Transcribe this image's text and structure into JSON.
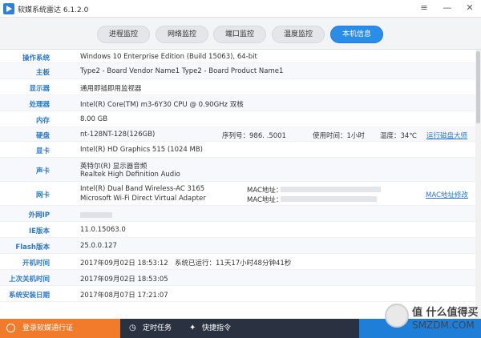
{
  "app": {
    "title": "软媒系统雷达 6.1.2.0"
  },
  "window_controls": {
    "menu": "≡",
    "minimize": "—",
    "close": "✕"
  },
  "tabs": [
    {
      "label": "进程监控",
      "active": false
    },
    {
      "label": "网络监控",
      "active": false
    },
    {
      "label": "端口监控",
      "active": false
    },
    {
      "label": "温度监控",
      "active": false
    },
    {
      "label": "本机信息",
      "active": true
    }
  ],
  "info": {
    "os": {
      "label": "操作系统",
      "value": "Windows 10 Enterprise Edition (Build 15063), 64-bit"
    },
    "board": {
      "label": "主板",
      "value": "Type2 - Board Vendor Name1 Type2 - Board Product Name1"
    },
    "display": {
      "label": "显示器",
      "value": "通用即插即用监视器"
    },
    "cpu": {
      "label": "处理器",
      "value": "Intel(R) Core(TM) m3-6Y30 CPU @ 0.90GHz 双核"
    },
    "memory": {
      "label": "内存",
      "value": "8.00 GB"
    },
    "disk": {
      "label": "硬盘",
      "value": "nt-128NT-128(126GB)",
      "serial": "序列号：986.   .5001",
      "usage": "使用时间：1小时",
      "temp": "温度：34℃",
      "link": "运行磁盘大师"
    },
    "gpu": {
      "label": "显卡",
      "value": "Intel(R) HD Graphics 515 (1024 MB)"
    },
    "sound": {
      "label": "声卡",
      "value1": "英特尔(R) 显示器音频",
      "value2": "Realtek High Definition Audio"
    },
    "network": {
      "label": "网卡",
      "value1": "Intel(R) Dual Band Wireless-AC 3165",
      "value2": "Microsoft Wi-Fi Direct Virtual Adapter",
      "mac1": "MAC地址：",
      "mac2": "MAC地址：",
      "link": "MAC地址修改"
    },
    "ip": {
      "label": "外网IP",
      "value": ""
    },
    "ie": {
      "label": "IE版本",
      "value": "11.0.15063.0"
    },
    "flash": {
      "label": "Flash版本",
      "value": "25.0.0.127"
    },
    "boot": {
      "label": "开机时间",
      "value": "2017年09月02日  18:53:12",
      "uptime": "系统已运行：11天17小时48分钟41秒"
    },
    "shutdown": {
      "label": "上次关机时间",
      "value": "2017年09月02日  18:53:05"
    },
    "install": {
      "label": "系统安装日期",
      "value": "2017年08月07日  17:21:07"
    }
  },
  "bottom": {
    "login": "登录软媒通行证",
    "timer": "定时任务",
    "shortcut": "快捷指令"
  },
  "watermark": {
    "line1": "值 什么值得买",
    "line2": "SMZDM.COM"
  }
}
